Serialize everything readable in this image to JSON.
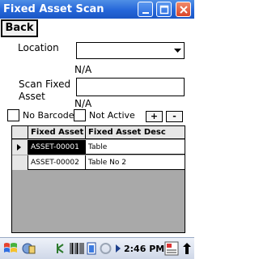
{
  "window": {
    "title": "Fixed Asset Scan"
  },
  "toolbar": {
    "back_label": "Back"
  },
  "form": {
    "location_label": "Location",
    "location_value": "",
    "location_status": "N/A",
    "scan_label_line1": "Scan Fixed",
    "scan_label_line2": "Asset",
    "scan_value": "",
    "scan_status": "N/A",
    "no_barcode_label": "No Barcode",
    "not_active_label": "Not Active",
    "add_label": "+",
    "remove_label": "-"
  },
  "grid": {
    "columns": [
      "Fixed Asset",
      "Fixed Asset Desc"
    ],
    "rows": [
      {
        "asset": "ASSET-00001",
        "desc": "Table",
        "current": true
      },
      {
        "asset": "ASSET-00002",
        "desc": "Table No 2",
        "current": false
      }
    ]
  },
  "taskbar": {
    "time": "2:46 PM"
  },
  "colors": {
    "titlebar": "#2566d9",
    "grid_background": "#a9a9a9",
    "selection": "#000000"
  }
}
